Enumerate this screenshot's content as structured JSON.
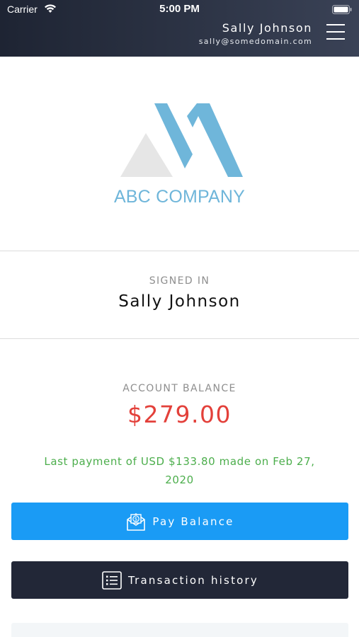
{
  "status_bar": {
    "carrier": "Carrier",
    "time": "5:00 PM"
  },
  "header": {
    "user_name": "Sally Johnson",
    "user_email": "sally@somedomain.com",
    "menu_icon": "hamburger-menu-icon"
  },
  "logo": {
    "text": "ABC COMPANY",
    "colors": {
      "primary": "#6fb6da",
      "secondary": "#e6e6e6"
    }
  },
  "signed_in": {
    "label": "SIGNED IN",
    "name": "Sally Johnson"
  },
  "balance": {
    "label": "ACCOUNT BALANCE",
    "amount": "$279.00",
    "color": "#e3403a"
  },
  "last_payment": {
    "text": "Last payment of USD $133.80 made on Feb 27, 2020",
    "color": "#4cae4c"
  },
  "buttons": {
    "pay_balance": {
      "label": "Pay Balance",
      "icon": "money-envelope-icon",
      "color": "#1a9bf5"
    },
    "transaction_history": {
      "label": "Transaction history",
      "icon": "list-icon",
      "color": "#222737"
    }
  }
}
